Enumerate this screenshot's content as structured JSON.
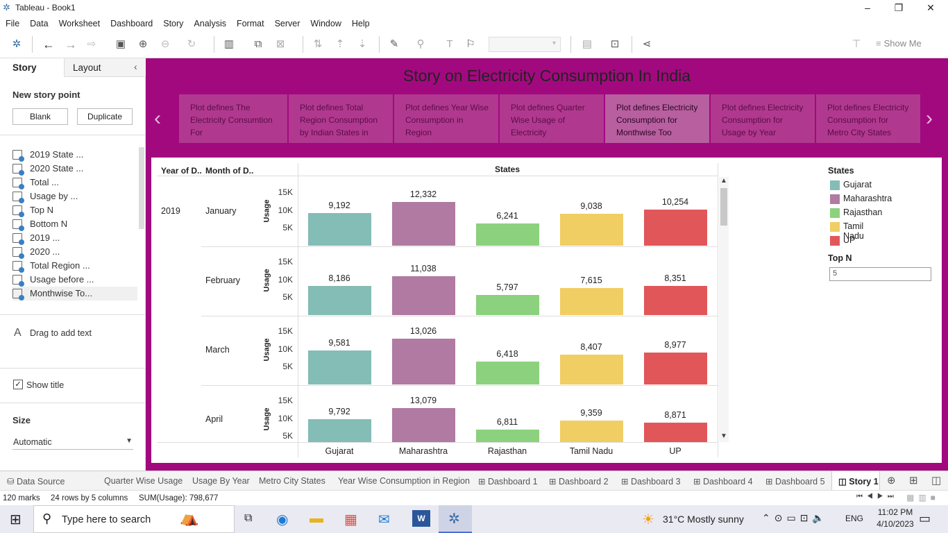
{
  "window": {
    "title": "Tableau - Book1"
  },
  "menu": [
    "File",
    "Data",
    "Worksheet",
    "Dashboard",
    "Story",
    "Analysis",
    "Format",
    "Server",
    "Window",
    "Help"
  ],
  "toolbar": {
    "show_me": "Show Me"
  },
  "left_pane": {
    "tab_story": "Story",
    "tab_layout": "Layout",
    "new_story_point": "New story point",
    "blank": "Blank",
    "duplicate": "Duplicate",
    "sheets": [
      "2019 State ...",
      "2020 State ...",
      "Total ...",
      "Usage by ...",
      "Top N",
      "Bottom N",
      "2019 ...",
      "2020 ...",
      "Total Region ...",
      "Usage before ...",
      "Monthwise To..."
    ],
    "drag_text": "Drag to add text",
    "show_title": "Show title",
    "size_label": "Size",
    "size_value": "Automatic"
  },
  "story": {
    "title": "Story on Electricity Consumption In India",
    "points": [
      "Plot defines The Electricity Consumtion For",
      "Plot defines Total Region Consumption by Indian States in",
      "Plot defines Year Wise Consumption in Region",
      "Plot defines Quarter Wise Usage of Electricity",
      "Plot defines Electricity Consumption for Monthwise Too",
      "Plot defines Electricity Consumption for Usage by Year",
      "Plot defines Electricity Consumption for Metro City States"
    ]
  },
  "viz": {
    "col_year": "Year of D..",
    "col_month": "Month of D..",
    "col_states": "States",
    "year": "2019",
    "usage_label": "Usage",
    "ticks": [
      "15K",
      "10K",
      "5K"
    ]
  },
  "chart_data": {
    "type": "bar",
    "categories": [
      "Gujarat",
      "Maharashtra",
      "Rajasthan",
      "Tamil Nadu",
      "UP"
    ],
    "rows": [
      {
        "month": "January",
        "values": [
          9192,
          12332,
          6241,
          9038,
          10254
        ],
        "labels": [
          "9,192",
          "12,332",
          "6,241",
          "9,038",
          "10,254"
        ]
      },
      {
        "month": "February",
        "values": [
          8186,
          11038,
          5797,
          7615,
          8351
        ],
        "labels": [
          "8,186",
          "11,038",
          "5,797",
          "7,615",
          "8,351"
        ]
      },
      {
        "month": "March",
        "values": [
          9581,
          13026,
          6418,
          8407,
          8977
        ],
        "labels": [
          "9,581",
          "13,026",
          "6,418",
          "8,407",
          "8,977"
        ]
      },
      {
        "month": "April",
        "values": [
          9792,
          13079,
          6811,
          9359,
          8871
        ],
        "labels": [
          "9,792",
          "13,079",
          "6,811",
          "9,359",
          "8,871"
        ]
      }
    ],
    "ylabel": "Usage",
    "colors": [
      "#84bcb6",
      "#b07aa2",
      "#8cd17d",
      "#f1ce63",
      "#e15759"
    ],
    "ylim": [
      0,
      15000
    ]
  },
  "legend": {
    "title": "States",
    "items": [
      "Gujarat",
      "Maharashtra",
      "Rajasthan",
      "Tamil Nadu",
      "UP"
    ],
    "topn_label": "Top N",
    "topn_value": "5"
  },
  "bottom_tabs": [
    "Data Source",
    "Quarter Wise Usage",
    "Usage By Year",
    "Metro City States",
    "Year Wise Consumption in Region",
    "Dashboard 1",
    "Dashboard 2",
    "Dashboard 3",
    "Dashboard 4",
    "Dashboard 5",
    "Story 1"
  ],
  "status": {
    "marks": "120 marks",
    "rows": "24 rows by 5 columns",
    "sum": "SUM(Usage): 798,677"
  },
  "taskbar": {
    "search": "Type here to search",
    "weather": "31°C  Mostly sunny",
    "lang": "ENG",
    "time": "11:02 PM",
    "date": "4/10/2023"
  }
}
